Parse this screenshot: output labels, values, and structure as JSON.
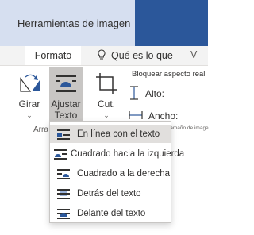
{
  "header": {
    "context_title": "Herramientas de imagen"
  },
  "tabs": {
    "active": "Formato",
    "tell_me": "Qué es lo que",
    "partial_next": "V"
  },
  "ribbon": {
    "rotate_label": "Girar",
    "wrap_label_line1": "Ajustar",
    "wrap_label_line2": "Texto",
    "crop_label": "Cut.",
    "group_label": "Arra",
    "lock_ratio": "Bloquear aspecto real",
    "height_label": "Alto:",
    "width_label": "Ancho:",
    "size_group": "Tamaño de image"
  },
  "menu": {
    "items": [
      {
        "label": "En línea con el texto",
        "icon": "inline-with-text-icon",
        "selected": true
      },
      {
        "label": "Cuadrado hacia la izquierda",
        "icon": "square-left-icon",
        "selected": false
      },
      {
        "label": "Cuadrado a la derecha",
        "icon": "square-right-icon",
        "selected": false
      },
      {
        "label": "Detrás del texto",
        "icon": "behind-text-icon",
        "selected": false
      },
      {
        "label": "Delante del texto",
        "icon": "in-front-of-text-icon",
        "selected": false
      }
    ]
  },
  "colors": {
    "titlebar": "#2b579a",
    "context_header": "#d6dff0",
    "accent_icon": "#2b579a"
  }
}
